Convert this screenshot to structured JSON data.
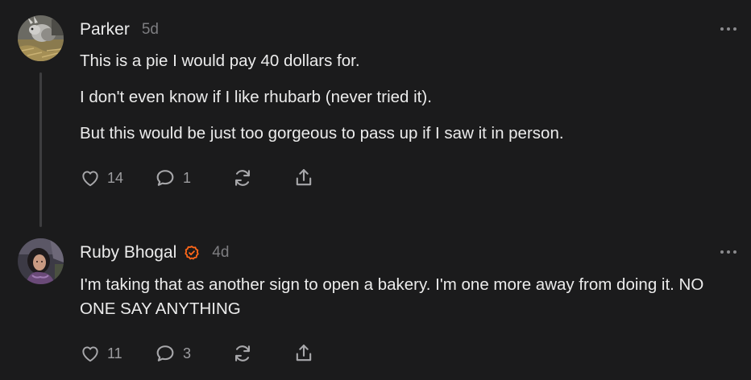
{
  "comments": [
    {
      "author": "Parker",
      "time": "5d",
      "paragraphs": [
        "This is a pie I would pay 40 dollars for.",
        "I don't even know if I like rhubarb (never tried it).",
        "But this would be just too gorgeous to pass up if I saw it in person."
      ],
      "likes": "14",
      "replies": "1",
      "avatar_icon": "rabbit-photo",
      "verified": false
    },
    {
      "author": "Ruby Bhogal",
      "time": "4d",
      "paragraphs": [
        "I'm taking that as another sign to open a bakery. I'm one more away from doing it. NO ONE SAY ANYTHING"
      ],
      "likes": "11",
      "replies": "3",
      "avatar_icon": "person-photo",
      "verified": true
    }
  ],
  "colors": {
    "background": "#1b1b1c",
    "text": "#ececec",
    "muted": "#7d7d80",
    "verified": "#ff6719",
    "thread_line": "#3d3d3f"
  },
  "icons": {
    "like": "heart-icon",
    "reply": "comment-bubble-icon",
    "restack": "restack-icon",
    "share": "share-icon",
    "more": "more-dots-icon",
    "verified": "verified-badge-icon"
  }
}
